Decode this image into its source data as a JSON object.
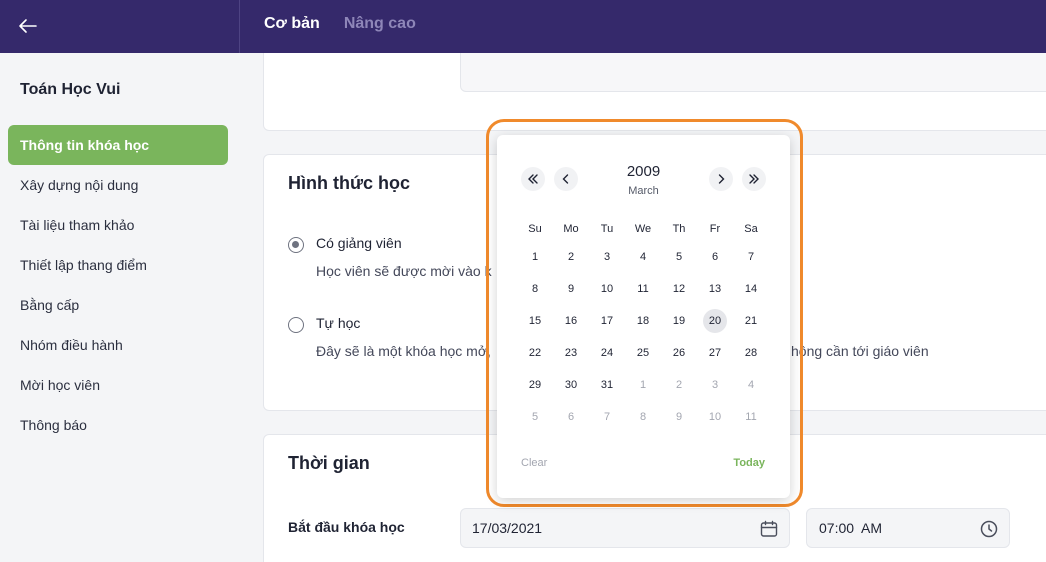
{
  "header": {
    "tabs": [
      {
        "label": "Cơ bản",
        "active": true
      },
      {
        "label": "Nâng cao",
        "active": false
      }
    ]
  },
  "sidebar": {
    "course_name": "Toán Học Vui",
    "items": [
      {
        "label": "Thông tin khóa học",
        "active": true
      },
      {
        "label": "Xây dựng nội dung"
      },
      {
        "label": "Tài liệu tham khảo"
      },
      {
        "label": "Thiết lập thang điểm"
      },
      {
        "label": "Bằng cấp"
      },
      {
        "label": "Nhóm điều hành"
      },
      {
        "label": "Mời học viên"
      },
      {
        "label": "Thông báo"
      }
    ]
  },
  "learning_mode": {
    "title": "Hình thức học",
    "options": [
      {
        "label": "Có giảng viên",
        "description": "Học viên sẽ được mời vào k",
        "checked": true
      },
      {
        "label": "Tự học",
        "description": "Đây sẽ là một khóa học mở,",
        "description_tail": "hông cần tới giáo viên",
        "checked": false
      }
    ]
  },
  "schedule": {
    "title": "Thời gian",
    "start_label": "Bắt đầu khóa học",
    "start_date": "17/03/2021",
    "start_time": "07:00  AM"
  },
  "datepicker": {
    "year": "2009",
    "month": "March",
    "weekdays": [
      "Su",
      "Mo",
      "Tu",
      "We",
      "Th",
      "Fr",
      "Sa"
    ],
    "days": [
      {
        "d": "1"
      },
      {
        "d": "2"
      },
      {
        "d": "3"
      },
      {
        "d": "4"
      },
      {
        "d": "5"
      },
      {
        "d": "6"
      },
      {
        "d": "7"
      },
      {
        "d": "8"
      },
      {
        "d": "9"
      },
      {
        "d": "10"
      },
      {
        "d": "11"
      },
      {
        "d": "12"
      },
      {
        "d": "13"
      },
      {
        "d": "14"
      },
      {
        "d": "15"
      },
      {
        "d": "16"
      },
      {
        "d": "17"
      },
      {
        "d": "18"
      },
      {
        "d": "19"
      },
      {
        "d": "20",
        "selected": true
      },
      {
        "d": "21"
      },
      {
        "d": "22"
      },
      {
        "d": "23"
      },
      {
        "d": "24"
      },
      {
        "d": "25"
      },
      {
        "d": "26"
      },
      {
        "d": "27"
      },
      {
        "d": "28"
      },
      {
        "d": "29"
      },
      {
        "d": "30"
      },
      {
        "d": "31"
      },
      {
        "d": "1",
        "other": true
      },
      {
        "d": "2",
        "other": true
      },
      {
        "d": "3",
        "other": true
      },
      {
        "d": "4",
        "other": true
      },
      {
        "d": "5",
        "other": true
      },
      {
        "d": "6",
        "other": true
      },
      {
        "d": "7",
        "other": true
      },
      {
        "d": "8",
        "other": true
      },
      {
        "d": "9",
        "other": true
      },
      {
        "d": "10",
        "other": true
      },
      {
        "d": "11",
        "other": true
      }
    ],
    "clear_label": "Clear",
    "today_label": "Today"
  },
  "colors": {
    "header_bg": "#35296b",
    "accent_green": "#7ab55c",
    "highlight_orange": "#f08a2c"
  },
  "icons": {
    "back": "arrow-left-icon",
    "calendar": "calendar-icon",
    "clock": "clock-icon",
    "prev_year": "double-chevron-left-icon",
    "prev_month": "chevron-left-icon",
    "next_month": "chevron-right-icon",
    "next_year": "double-chevron-right-icon"
  }
}
